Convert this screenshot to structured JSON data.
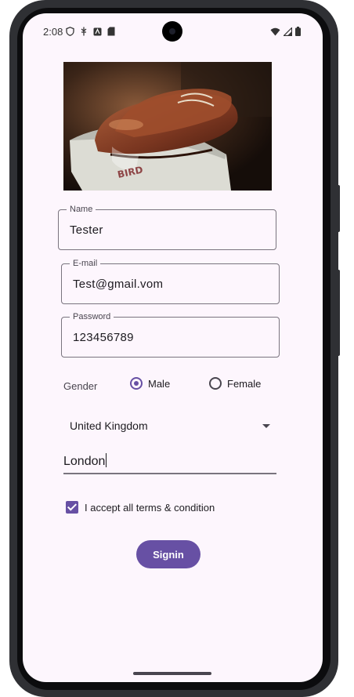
{
  "status_bar": {
    "time": "2:08"
  },
  "form": {
    "name_label": "Name",
    "name_value": "Tester",
    "email_label": "E-mail",
    "email_value": "Test@gmail.vom",
    "password_label": "Password",
    "password_value": "123456789",
    "gender_label": "Gender",
    "gender_options": [
      "Male",
      "Female"
    ],
    "gender_selected": "Male",
    "country_selected": "United Kingdom",
    "city_value": "London",
    "terms_label": "I accept all terms & condition",
    "terms_checked": true,
    "signin_label": "Signin"
  },
  "colors": {
    "accent": "#6750a4",
    "background": "#fdf6fd",
    "outline": "#79747e"
  }
}
